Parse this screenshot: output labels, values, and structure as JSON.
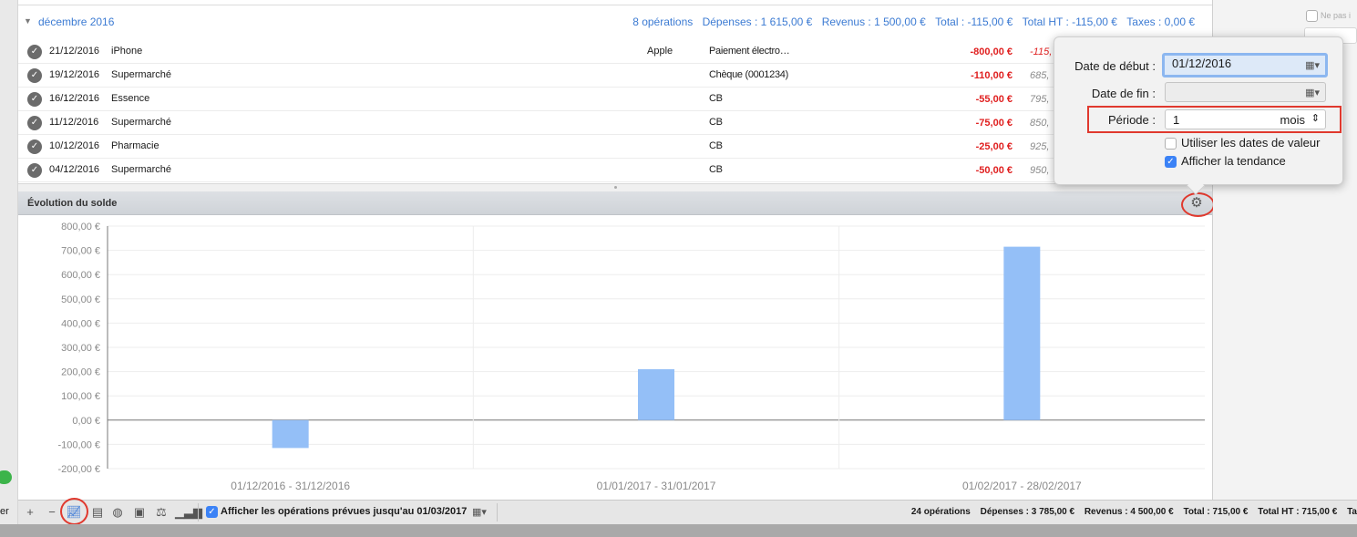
{
  "month_group": {
    "name": "décembre 2016",
    "operations": "8 opérations",
    "expenses": "Dépenses : 1 615,00 €",
    "income": "Revenus : 1 500,00 €",
    "total": "Total : -115,00 €",
    "total_ht": "Total HT : -115,00 €",
    "taxes": "Taxes : 0,00 €"
  },
  "operations": [
    {
      "date": "21/12/2016",
      "description": "iPhone",
      "payee": "Apple",
      "mode": "Paiement électro…",
      "amount": "-800,00 €",
      "balance": "-115,",
      "balance_negative": true
    },
    {
      "date": "19/12/2016",
      "description": "Supermarché",
      "payee": "",
      "mode": "Chèque (0001234)",
      "amount": "-110,00 €",
      "balance": "685,",
      "balance_negative": false
    },
    {
      "date": "16/12/2016",
      "description": "Essence",
      "payee": "",
      "mode": "CB",
      "amount": "-55,00 €",
      "balance": "795,",
      "balance_negative": false
    },
    {
      "date": "11/12/2016",
      "description": "Supermarché",
      "payee": "",
      "mode": "CB",
      "amount": "-75,00 €",
      "balance": "850,",
      "balance_negative": false
    },
    {
      "date": "10/12/2016",
      "description": "Pharmacie",
      "payee": "",
      "mode": "CB",
      "amount": "-25,00 €",
      "balance": "925,",
      "balance_negative": false
    },
    {
      "date": "04/12/2016",
      "description": "Supermarché",
      "payee": "",
      "mode": "CB",
      "amount": "-50,00 €",
      "balance": "950,",
      "balance_negative": false
    }
  ],
  "chart_panel": {
    "title": "Évolution du solde",
    "gear_icon": "gear-icon"
  },
  "chart_data": {
    "type": "bar",
    "categories": [
      "01/12/2016 - 31/12/2016",
      "01/01/2017 - 31/01/2017",
      "01/02/2017 - 28/02/2017"
    ],
    "values": [
      -115,
      210,
      715
    ],
    "ylim": [
      -200,
      800
    ],
    "yticks": [
      -200,
      -100,
      0,
      100,
      200,
      300,
      400,
      500,
      600,
      700,
      800
    ],
    "ytick_labels": [
      "-200,00 €",
      "-100,00 €",
      "0,00 €",
      "100,00 €",
      "200,00 €",
      "300,00 €",
      "400,00 €",
      "500,00 €",
      "600,00 €",
      "700,00 €",
      "800,00 €"
    ],
    "bar_color": "#94bff7",
    "grid": true,
    "title": "",
    "xlabel": "",
    "ylabel": ""
  },
  "popover": {
    "start_label": "Date de début :",
    "start_value": "01/12/2016",
    "end_label": "Date de fin :",
    "end_value": "",
    "period_label": "Période :",
    "period_value": "1",
    "period_unit": "mois",
    "use_value_dates_label": "Utiliser les dates de valeur",
    "use_value_dates_checked": false,
    "show_trend_label": "Afficher la tendance",
    "show_trend_checked": true
  },
  "bottom_bar": {
    "left_text": "er",
    "planned_label": "Afficher les opérations prévues jusqu'au 01/03/2017",
    "planned_checked": true,
    "stats": {
      "operations": "24 opérations",
      "expenses": "Dépenses : 3 785,00 €",
      "income": "Revenus : 4 500,00 €",
      "total": "Total : 715,00 €",
      "total_ht": "Total HT : 715,00 €",
      "taxes": "Ta"
    }
  },
  "right_panel": {
    "ne_pas_label": "Ne pas i"
  }
}
